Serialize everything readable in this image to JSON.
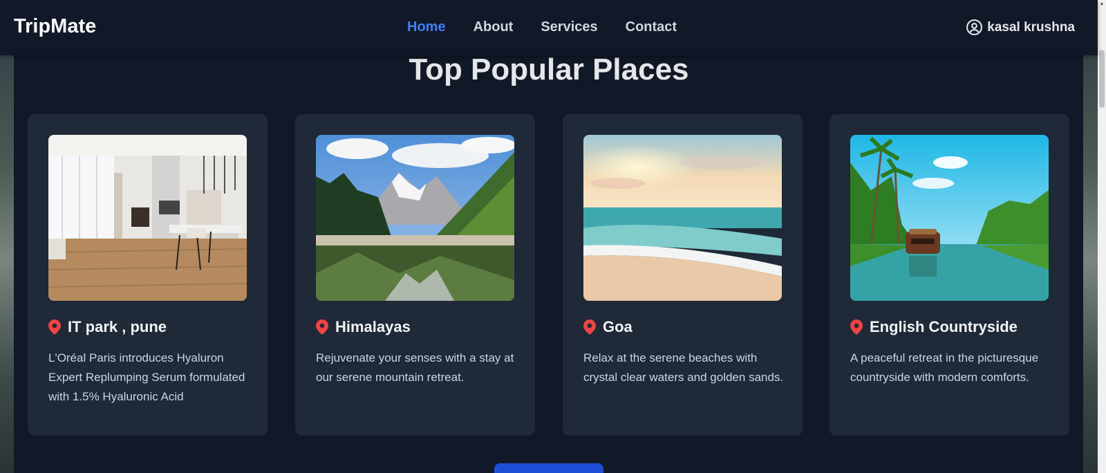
{
  "brand": "TripMate",
  "nav": {
    "links": [
      "Home",
      "About",
      "Services",
      "Contact"
    ],
    "active": "Home"
  },
  "user": {
    "name": "kasal krushna",
    "icon": "user-circle-icon"
  },
  "section": {
    "title": "Top Popular Places"
  },
  "cards": [
    {
      "title": "IT park , pune",
      "description": "L'Oréal Paris introduces Hyaluron Expert Replumping Serum formulated with 1.5% Hyaluronic Acid",
      "image": "modern-apartment-interior",
      "icon": "location-pin-icon"
    },
    {
      "title": "Himalayas",
      "description": "Rejuvenate your senses with a stay at our serene mountain retreat.",
      "image": "mountain-lake-forest",
      "icon": "location-pin-icon"
    },
    {
      "title": "Goa",
      "description": "Relax at the serene beaches with crystal clear waters and golden sands.",
      "image": "beach-sunset",
      "icon": "location-pin-icon"
    },
    {
      "title": "English Countryside",
      "description": "A peaceful retreat in the picturesque countryside with modern comforts.",
      "image": "river-houseboat-palms",
      "icon": "location-pin-icon"
    }
  ],
  "colors": {
    "background": "#111827",
    "card": "#1f2937",
    "accent": "#3b82f6",
    "pin": "#ef4444",
    "button": "#1d4ed8"
  }
}
